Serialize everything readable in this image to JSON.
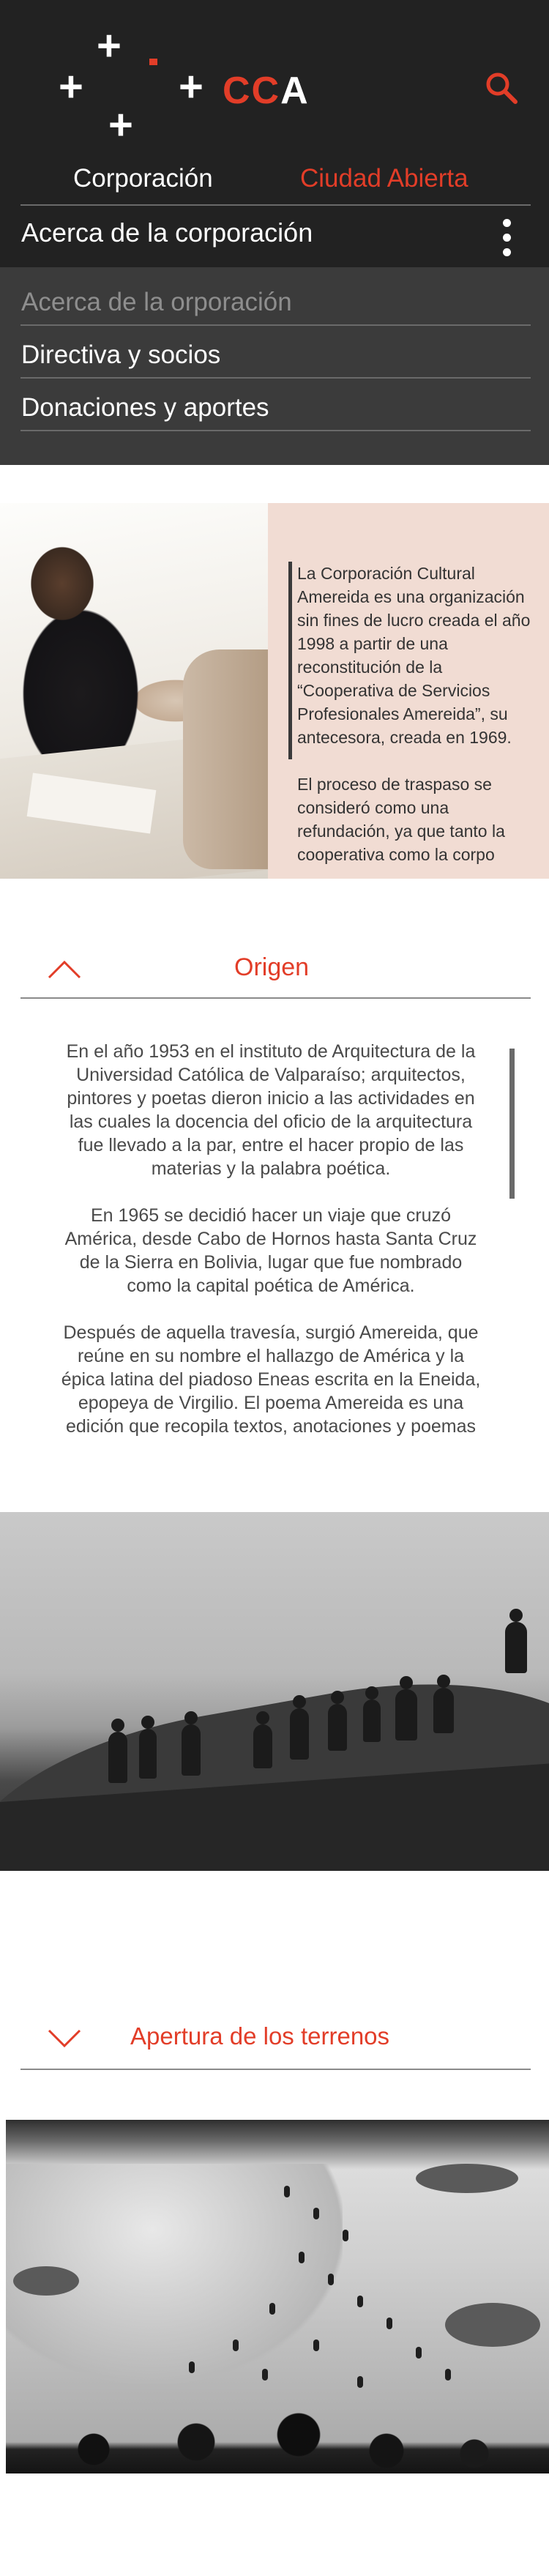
{
  "header": {
    "logo_text_accent": "CC",
    "logo_text_main": "A",
    "tabs": [
      {
        "label": "Corporación",
        "color": "#ffffff"
      },
      {
        "label": "Ciudad Abierta",
        "color": "#e23d28"
      }
    ],
    "section_select": {
      "current": "Acerca de la corporación"
    },
    "dropdown": [
      {
        "label": "Acerca de la  orporación"
      },
      {
        "label": "Directiva y socios"
      },
      {
        "label": "Donaciones y aportes"
      }
    ]
  },
  "intro": {
    "paragraphs": [
      "La Corporación Cultural Amereida es una organización sin fines de lucro creada el año 1998 a partir de una reconstitución de la “Cooperativa de Servicios Profesionales Amereida”, su antecesora, creada en 1969.",
      "El proceso de traspaso se consideró como una refundación, ya que tanto la cooperativa como la corpo"
    ]
  },
  "sections": {
    "origen": {
      "title": "Origen",
      "paragraphs": [
        "En el año 1953 en el instituto de Arquitectura de la Universidad Católica de Valparaíso;  arquitectos, pintores y poetas dieron inicio a las actividades en las cuales la docencia del oficio de la arquitectura fue llevado a la par, entre el hacer propio de las materias y la palabra poética.",
        "En 1965 se decidió hacer un viaje que cruzó América, desde Cabo de Hornos hasta Santa Cruz de la Sierra en Bolivia, lugar que fue nombrado como la capital poética de América.",
        "Después de aquella travesía, surgió Amereida, que reúne en su nombre el hallazgo de América y la épica latina del piadoso Eneas escrita en la Eneida, epopeya de Virgilio. El poema Amereida es una edición que recopila textos, anotaciones y poemas"
      ]
    },
    "apertura": {
      "title": "Apertura de los terrenos"
    }
  },
  "colors": {
    "accent": "#e23d28",
    "header_bg": "#222222",
    "dropdown_bg": "#3b3b3b",
    "intro_panel_bg": "#f1dcd3"
  }
}
